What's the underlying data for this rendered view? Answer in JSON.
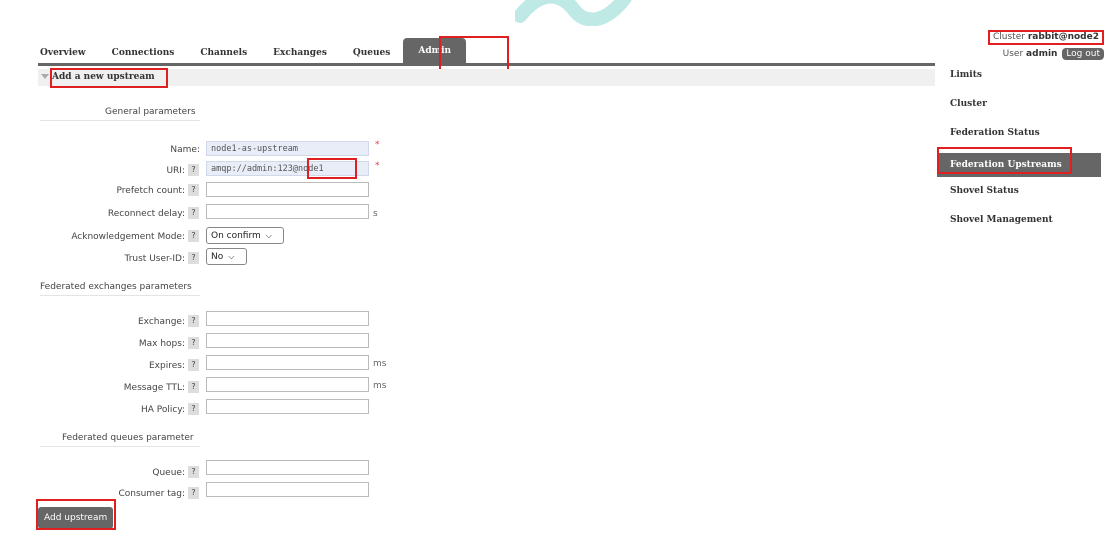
{
  "nav": {
    "tabs": [
      {
        "label": "Overview"
      },
      {
        "label": "Connections"
      },
      {
        "label": "Channels"
      },
      {
        "label": "Exchanges"
      },
      {
        "label": "Queues"
      },
      {
        "label": "Admin",
        "active": true
      }
    ]
  },
  "header": {
    "cluster_label": "Cluster",
    "cluster_name": "rabbit@node2",
    "user_label": "User",
    "user_name": "admin",
    "logout_label": "Log out"
  },
  "sidebar": {
    "items": [
      {
        "label": "Limits"
      },
      {
        "label": "Cluster"
      },
      {
        "label": "Federation Status"
      },
      {
        "label": "Federation Upstreams",
        "active": true
      },
      {
        "label": "Shovel Status"
      },
      {
        "label": "Shovel Management"
      }
    ]
  },
  "form": {
    "section_title": "Add a new upstream",
    "general_title": "General parameters",
    "help_glyph": "?",
    "required_mark": "*",
    "name": {
      "label": "Name:",
      "value": "node1-as-upstream"
    },
    "uri": {
      "label": "URI:",
      "value": "amqp://admin:123@node1"
    },
    "prefetch": {
      "label": "Prefetch count:",
      "value": ""
    },
    "reconnect": {
      "label": "Reconnect delay:",
      "value": "",
      "unit": "s"
    },
    "ack_mode": {
      "label": "Acknowledgement Mode:",
      "value": "On confirm"
    },
    "trust_user": {
      "label": "Trust User-ID:",
      "value": "No"
    },
    "exchanges_title": "Federated exchanges parameters",
    "exchange": {
      "label": "Exchange:",
      "value": ""
    },
    "max_hops": {
      "label": "Max hops:",
      "value": ""
    },
    "expires": {
      "label": "Expires:",
      "value": "",
      "unit": "ms"
    },
    "message_ttl": {
      "label": "Message TTL:",
      "value": "",
      "unit": "ms"
    },
    "ha_policy": {
      "label": "HA Policy:",
      "value": ""
    },
    "queues_title": "Federated queues parameter",
    "queue": {
      "label": "Queue:",
      "value": ""
    },
    "consumer_tag": {
      "label": "Consumer tag:",
      "value": ""
    },
    "submit_label": "Add upstream"
  },
  "colors": {
    "accent": "#666666",
    "highlight": "#e02020",
    "input_filled": "#e8edf8"
  }
}
